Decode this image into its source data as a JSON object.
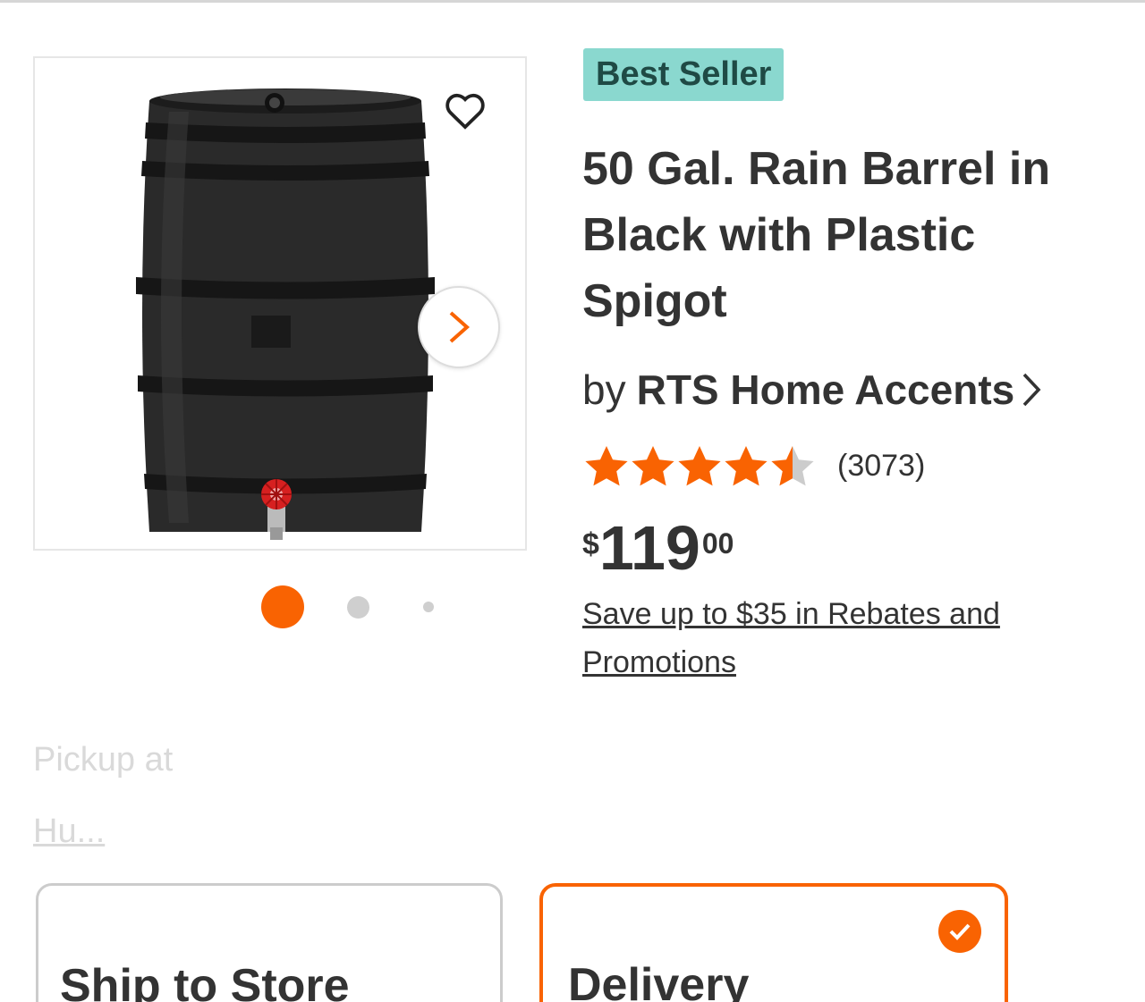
{
  "gallery": {
    "image_alt": "Black plastic rain barrel with red spigot valve",
    "active_dot": 1,
    "dot_count": 3
  },
  "product": {
    "badge": "Best Seller",
    "title": "50 Gal. Rain Barrel in Black with Plastic Spigot",
    "by_prefix": "by",
    "brand": "RTS Home Accents",
    "rating": 4.5,
    "rating_max": 5,
    "review_count": "(3073)",
    "price_symbol": "$",
    "price_dollars": "119",
    "price_cents": "00",
    "rebates_link": "Save up to $35 in Rebates and Promotions"
  },
  "pickup": {
    "label": "Pickup at",
    "store": "Hu..."
  },
  "fulfillment": {
    "options": [
      {
        "label": "Ship to Store",
        "selected": false
      },
      {
        "label": "Delivery",
        "selected": true
      }
    ]
  },
  "colors": {
    "accent": "#f96302",
    "badge_bg": "#8ad8cf",
    "star": "#f96302",
    "star_empty": "#cccccc"
  },
  "icons": {
    "favorite": "heart-outline-icon",
    "next": "chevron-right-icon",
    "brand_link": "chevron-right-icon",
    "selected": "check-icon"
  }
}
